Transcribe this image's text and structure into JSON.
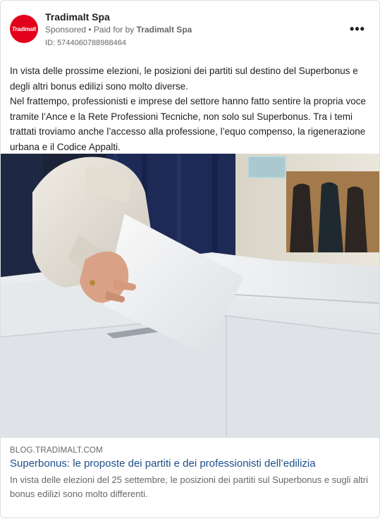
{
  "ad": {
    "page_name": "Tradimalt Spa",
    "avatar_text": "Tradimalt",
    "brand_color": "#e2001a",
    "sponsored": "Sponsored",
    "separator": " • ",
    "paid_for_prefix": "Paid for by ",
    "paid_for_name": "Tradimalt Spa",
    "id_label": "ID: 5744060788988464",
    "more_icon": "more-horizontal-icon"
  },
  "body": {
    "paragraph_1": "In vista delle prossime elezioni, le posizioni dei partiti sul destino del Superbonus e degli altri bonus edilizi sono molto diverse.",
    "paragraph_2": "Nel frattempo, professionisti e imprese del settore hanno fatto sentire la propria voce tramite l’Ance e la Rete Professioni Tecniche, non solo sul Superbonus. Tra i temi trattati troviamo anche l’accesso alla professione, l’equo compenso, la rigenerazione urbana e il Codice Appalti."
  },
  "link": {
    "domain": "BLOG.TRADIMALT.COM",
    "headline": "Superbonus: le proposte dei partiti e dei professionisti dell’edilizia",
    "description": "In vista delle elezioni del 25 settembre, le posizioni dei partiti sul Superbonus e sugli altri bonus edilizi sono molto differenti."
  }
}
